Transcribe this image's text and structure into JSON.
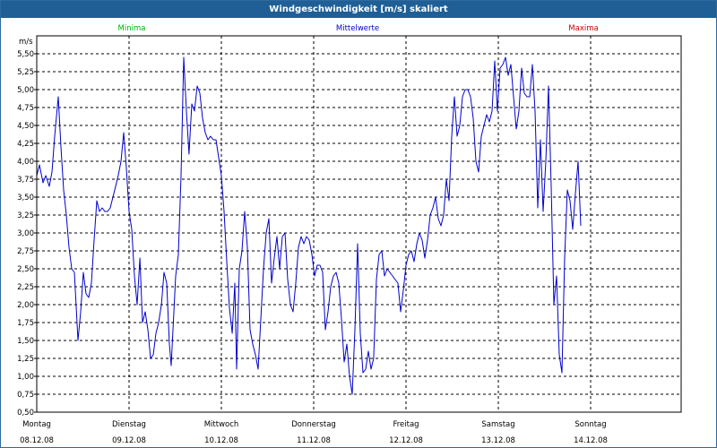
{
  "window": {
    "title": "Windgeschwindigkeit [m/s] skaliert"
  },
  "legend": [
    {
      "label": "Minima",
      "color": "#00b000"
    },
    {
      "label": "Mittelwerte",
      "color": "#0000cc"
    },
    {
      "label": "Maxima",
      "color": "#cc0000"
    }
  ],
  "chart_data": {
    "type": "line",
    "title": "Windgeschwindigkeit [m/s] skaliert",
    "ylabel": "m/s",
    "ylim": [
      0.5,
      5.6
    ],
    "xlim": [
      0,
      7.2
    ],
    "yticks": [
      "0,50",
      "0,75",
      "1,00",
      "1,25",
      "1,50",
      "1,75",
      "2,00",
      "2,25",
      "2,50",
      "2,75",
      "3,00",
      "3,25",
      "3,50",
      "3,75",
      "4,00",
      "4,25",
      "4,50",
      "4,75",
      "5,00",
      "5,25",
      "5,50"
    ],
    "x_categories": [
      {
        "day": "Montag",
        "date": "08.12.08"
      },
      {
        "day": "Dienstag",
        "date": "09.12.08"
      },
      {
        "day": "Mittwoch",
        "date": "10.12.08"
      },
      {
        "day": "Donnerstag",
        "date": "11.12.08"
      },
      {
        "day": "Freitag",
        "date": "12.12.08"
      },
      {
        "day": "Samstag",
        "date": "13.12.08"
      },
      {
        "day": "Sonntag",
        "date": "14.12.08"
      }
    ],
    "grid": true,
    "series": [
      {
        "name": "Mittelwerte",
        "color": "#0000cc",
        "points": [
          [
            0.0,
            3.8
          ],
          [
            0.029,
            3.95
          ],
          [
            0.068,
            3.7
          ],
          [
            0.097,
            3.8
          ],
          [
            0.136,
            3.65
          ],
          [
            0.165,
            3.85
          ],
          [
            0.194,
            4.35
          ],
          [
            0.233,
            4.9
          ],
          [
            0.262,
            4.2
          ],
          [
            0.291,
            3.6
          ],
          [
            0.32,
            3.25
          ],
          [
            0.35,
            2.8
          ],
          [
            0.379,
            2.5
          ],
          [
            0.408,
            2.45
          ],
          [
            0.447,
            1.5
          ],
          [
            0.476,
            1.9
          ],
          [
            0.505,
            2.45
          ],
          [
            0.534,
            2.15
          ],
          [
            0.563,
            2.1
          ],
          [
            0.592,
            2.3
          ],
          [
            0.621,
            2.9
          ],
          [
            0.65,
            3.45
          ],
          [
            0.68,
            3.3
          ],
          [
            0.709,
            3.35
          ],
          [
            0.738,
            3.3
          ],
          [
            0.767,
            3.3
          ],
          [
            0.796,
            3.35
          ],
          [
            0.825,
            3.5
          ],
          [
            0.854,
            3.65
          ],
          [
            0.883,
            3.8
          ],
          [
            0.913,
            4.0
          ],
          [
            0.942,
            4.4
          ],
          [
            0.971,
            3.9
          ],
          [
            1.0,
            3.3
          ],
          [
            1.029,
            3.05
          ],
          [
            1.058,
            2.4
          ],
          [
            1.087,
            2.0
          ],
          [
            1.117,
            2.65
          ],
          [
            1.146,
            1.75
          ],
          [
            1.175,
            1.9
          ],
          [
            1.204,
            1.65
          ],
          [
            1.233,
            1.25
          ],
          [
            1.262,
            1.3
          ],
          [
            1.291,
            1.6
          ],
          [
            1.32,
            1.75
          ],
          [
            1.35,
            2.0
          ],
          [
            1.379,
            2.45
          ],
          [
            1.408,
            2.3
          ],
          [
            1.437,
            1.45
          ],
          [
            1.456,
            1.15
          ],
          [
            1.476,
            1.65
          ],
          [
            1.505,
            2.4
          ],
          [
            1.534,
            2.7
          ],
          [
            1.563,
            3.8
          ],
          [
            1.592,
            5.45
          ],
          [
            1.621,
            4.7
          ],
          [
            1.65,
            4.1
          ],
          [
            1.68,
            4.8
          ],
          [
            1.709,
            4.7
          ],
          [
            1.738,
            5.05
          ],
          [
            1.767,
            4.95
          ],
          [
            1.796,
            4.6
          ],
          [
            1.825,
            4.4
          ],
          [
            1.854,
            4.3
          ],
          [
            1.883,
            4.35
          ],
          [
            1.913,
            4.3
          ],
          [
            1.942,
            4.3
          ],
          [
            1.971,
            4.05
          ],
          [
            2.0,
            3.8
          ],
          [
            2.029,
            3.3
          ],
          [
            2.058,
            2.6
          ],
          [
            2.087,
            1.95
          ],
          [
            2.117,
            1.6
          ],
          [
            2.146,
            2.3
          ],
          [
            2.165,
            1.1
          ],
          [
            2.194,
            2.5
          ],
          [
            2.223,
            2.75
          ],
          [
            2.252,
            3.3
          ],
          [
            2.282,
            2.8
          ],
          [
            2.311,
            1.65
          ],
          [
            2.34,
            1.45
          ],
          [
            2.369,
            1.3
          ],
          [
            2.398,
            1.1
          ],
          [
            2.427,
            1.8
          ],
          [
            2.456,
            2.5
          ],
          [
            2.485,
            3.0
          ],
          [
            2.515,
            3.2
          ],
          [
            2.544,
            2.3
          ],
          [
            2.573,
            2.65
          ],
          [
            2.602,
            2.95
          ],
          [
            2.631,
            2.5
          ],
          [
            2.66,
            2.95
          ],
          [
            2.689,
            3.0
          ],
          [
            2.718,
            2.35
          ],
          [
            2.748,
            2.0
          ],
          [
            2.777,
            1.9
          ],
          [
            2.806,
            2.3
          ],
          [
            2.835,
            2.8
          ],
          [
            2.864,
            2.95
          ],
          [
            2.893,
            2.85
          ],
          [
            2.922,
            2.95
          ],
          [
            2.951,
            2.9
          ],
          [
            2.981,
            2.7
          ],
          [
            3.01,
            2.4
          ],
          [
            3.039,
            2.55
          ],
          [
            3.068,
            2.55
          ],
          [
            3.097,
            2.45
          ],
          [
            3.126,
            1.65
          ],
          [
            3.155,
            1.9
          ],
          [
            3.184,
            2.25
          ],
          [
            3.214,
            2.4
          ],
          [
            3.243,
            2.45
          ],
          [
            3.272,
            2.3
          ],
          [
            3.301,
            1.8
          ],
          [
            3.33,
            1.2
          ],
          [
            3.359,
            1.45
          ],
          [
            3.388,
            1.0
          ],
          [
            3.417,
            0.75
          ],
          [
            3.447,
            1.65
          ],
          [
            3.476,
            2.85
          ],
          [
            3.505,
            1.6
          ],
          [
            3.534,
            1.05
          ],
          [
            3.563,
            1.1
          ],
          [
            3.592,
            1.35
          ],
          [
            3.621,
            1.1
          ],
          [
            3.65,
            1.25
          ],
          [
            3.68,
            2.35
          ],
          [
            3.709,
            2.7
          ],
          [
            3.738,
            2.75
          ],
          [
            3.767,
            2.4
          ],
          [
            3.796,
            2.5
          ],
          [
            3.825,
            2.45
          ],
          [
            3.854,
            2.4
          ],
          [
            3.883,
            2.35
          ],
          [
            3.913,
            2.3
          ],
          [
            3.942,
            1.9
          ],
          [
            3.971,
            2.2
          ],
          [
            4.0,
            2.55
          ],
          [
            4.029,
            2.7
          ],
          [
            4.058,
            2.75
          ],
          [
            4.087,
            2.6
          ],
          [
            4.117,
            2.85
          ],
          [
            4.146,
            3.0
          ],
          [
            4.175,
            2.9
          ],
          [
            4.204,
            2.65
          ],
          [
            4.233,
            2.9
          ],
          [
            4.262,
            3.25
          ],
          [
            4.291,
            3.35
          ],
          [
            4.32,
            3.5
          ],
          [
            4.35,
            3.2
          ],
          [
            4.379,
            3.1
          ],
          [
            4.408,
            3.25
          ],
          [
            4.437,
            3.75
          ],
          [
            4.466,
            3.45
          ],
          [
            4.495,
            4.35
          ],
          [
            4.524,
            4.9
          ],
          [
            4.553,
            4.35
          ],
          [
            4.583,
            4.5
          ],
          [
            4.612,
            4.9
          ],
          [
            4.641,
            5.0
          ],
          [
            4.67,
            5.0
          ],
          [
            4.699,
            4.9
          ],
          [
            4.728,
            4.6
          ],
          [
            4.757,
            4.0
          ],
          [
            4.786,
            3.85
          ],
          [
            4.816,
            4.35
          ],
          [
            4.845,
            4.5
          ],
          [
            4.874,
            4.65
          ],
          [
            4.903,
            4.55
          ],
          [
            4.932,
            4.7
          ],
          [
            4.961,
            5.4
          ],
          [
            4.99,
            4.7
          ],
          [
            5.019,
            5.3
          ],
          [
            5.049,
            5.35
          ],
          [
            5.078,
            5.45
          ],
          [
            5.107,
            5.2
          ],
          [
            5.136,
            5.35
          ],
          [
            5.165,
            4.9
          ],
          [
            5.194,
            4.45
          ],
          [
            5.223,
            4.7
          ],
          [
            5.252,
            5.3
          ],
          [
            5.282,
            4.95
          ],
          [
            5.311,
            4.9
          ],
          [
            5.34,
            4.9
          ],
          [
            5.369,
            5.35
          ],
          [
            5.398,
            4.7
          ],
          [
            5.427,
            3.35
          ],
          [
            5.456,
            4.3
          ],
          [
            5.485,
            3.3
          ],
          [
            5.515,
            4.0
          ],
          [
            5.544,
            5.05
          ],
          [
            5.573,
            3.65
          ],
          [
            5.602,
            2.0
          ],
          [
            5.631,
            2.4
          ],
          [
            5.66,
            1.3
          ],
          [
            5.689,
            1.05
          ],
          [
            5.718,
            2.65
          ],
          [
            5.748,
            3.6
          ],
          [
            5.777,
            3.45
          ],
          [
            5.806,
            3.05
          ],
          [
            5.835,
            3.55
          ],
          [
            5.864,
            4.0
          ],
          [
            5.893,
            3.1
          ]
        ]
      }
    ]
  }
}
